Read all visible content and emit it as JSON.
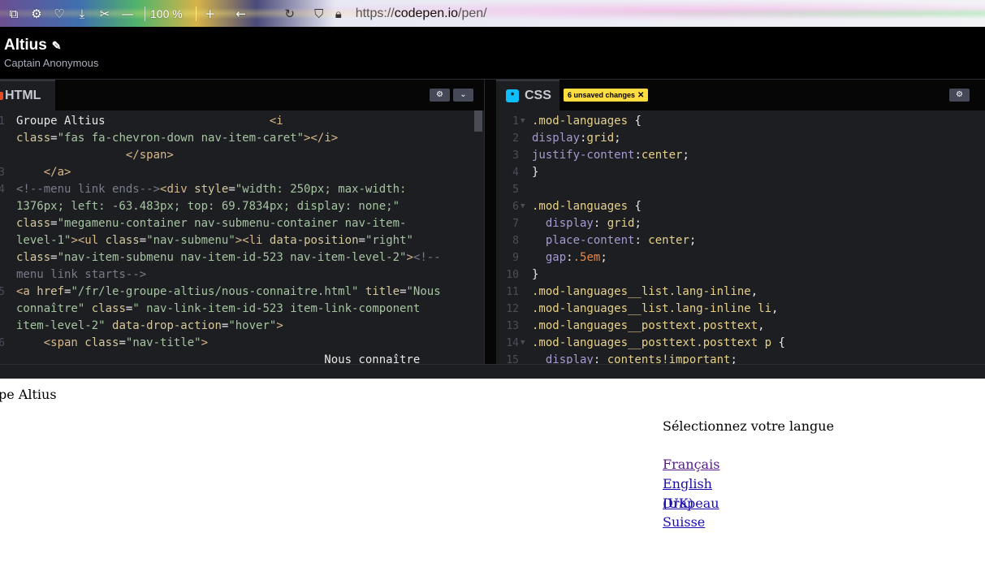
{
  "browser": {
    "zoom": "100 %",
    "url_scheme": "https://",
    "url_host": "codepen.io",
    "url_path": "/pen/",
    "icons": [
      "extensions-icon",
      "settings-icon",
      "pocket-icon",
      "download-icon",
      "screenshot-icon",
      "zoom-out-icon",
      "zoom-in-icon",
      "back-icon",
      "reload-icon",
      "shield-icon",
      "lock-icon"
    ]
  },
  "pen": {
    "title": "Altius",
    "author": "Captain Anonymous"
  },
  "html_pane": {
    "tab_label": "HTML",
    "lines": [
      {
        "n": "1",
        "parts": [
          {
            "c": "c-plain",
            "t": "Groupe Altius"
          },
          {
            "c": "c-tag",
            "t": "                        <i",
            "x": 0
          }
        ]
      },
      {
        "n": "",
        "parts": [
          {
            "c": "c-attr",
            "t": "class"
          },
          {
            "c": "c-plain",
            "t": "="
          },
          {
            "c": "c-str",
            "t": "\"fas fa-chevron-down nav-item-caret\""
          },
          {
            "c": "c-tag",
            "t": "></i>"
          }
        ]
      },
      {
        "n": "",
        "parts": [
          {
            "c": "c-tag",
            "t": "                </span>"
          }
        ]
      },
      {
        "n": "3",
        "parts": [
          {
            "c": "c-tag",
            "t": "    </a>"
          }
        ]
      },
      {
        "n": "4",
        "parts": [
          {
            "c": "c-comment",
            "t": "<!--menu link ends-->"
          },
          {
            "c": "c-tag",
            "t": "<div "
          },
          {
            "c": "c-attr",
            "t": "style"
          },
          {
            "c": "c-plain",
            "t": "="
          },
          {
            "c": "c-str",
            "t": "\"width: 250px; max-width:"
          }
        ]
      },
      {
        "n": "",
        "parts": [
          {
            "c": "c-str",
            "t": "1376px; left: -63.483px; top: 69.7834px; display: none;\""
          }
        ]
      },
      {
        "n": "",
        "parts": [
          {
            "c": "c-attr",
            "t": "class"
          },
          {
            "c": "c-plain",
            "t": "="
          },
          {
            "c": "c-str",
            "t": "\"megamenu-container nav-submenu-container nav-item-"
          }
        ]
      },
      {
        "n": "",
        "parts": [
          {
            "c": "c-str",
            "t": "level-1\""
          },
          {
            "c": "c-tag",
            "t": "><ul "
          },
          {
            "c": "c-attr",
            "t": "class"
          },
          {
            "c": "c-plain",
            "t": "="
          },
          {
            "c": "c-str",
            "t": "\"nav-submenu\""
          },
          {
            "c": "c-tag",
            "t": "><li "
          },
          {
            "c": "c-attr",
            "t": "data-position"
          },
          {
            "c": "c-plain",
            "t": "="
          },
          {
            "c": "c-str",
            "t": "\"right\""
          }
        ]
      },
      {
        "n": "",
        "parts": [
          {
            "c": "c-attr",
            "t": "class"
          },
          {
            "c": "c-plain",
            "t": "="
          },
          {
            "c": "c-str",
            "t": "\"nav-item-submenu nav-item-id-523 nav-item-level-2\""
          },
          {
            "c": "c-tag",
            "t": ">"
          },
          {
            "c": "c-comment",
            "t": "<!--"
          }
        ]
      },
      {
        "n": "",
        "parts": [
          {
            "c": "c-comment",
            "t": "menu link starts-->"
          }
        ]
      },
      {
        "n": "5",
        "parts": [
          {
            "c": "c-tag",
            "t": "<a "
          },
          {
            "c": "c-attr",
            "t": "href"
          },
          {
            "c": "c-plain",
            "t": "="
          },
          {
            "c": "c-str",
            "t": "\"/fr/le-groupe-altius/nous-connaitre.html\""
          },
          {
            "c": "c-plain",
            "t": " "
          },
          {
            "c": "c-attr",
            "t": "title"
          },
          {
            "c": "c-plain",
            "t": "="
          },
          {
            "c": "c-str",
            "t": "\"Nous"
          }
        ]
      },
      {
        "n": "",
        "parts": [
          {
            "c": "c-str",
            "t": "connaître\""
          },
          {
            "c": "c-plain",
            "t": " "
          },
          {
            "c": "c-attr",
            "t": "class"
          },
          {
            "c": "c-plain",
            "t": "="
          },
          {
            "c": "c-str",
            "t": "\" nav-link-item-id-523 item-link-component"
          }
        ]
      },
      {
        "n": "",
        "parts": [
          {
            "c": "c-str",
            "t": "item-level-2\""
          },
          {
            "c": "c-plain",
            "t": " "
          },
          {
            "c": "c-attr",
            "t": "data-drop-action"
          },
          {
            "c": "c-plain",
            "t": "="
          },
          {
            "c": "c-str",
            "t": "\"hover\""
          },
          {
            "c": "c-tag",
            "t": ">"
          }
        ]
      },
      {
        "n": "6",
        "parts": [
          {
            "c": "c-tag",
            "t": "    <span "
          },
          {
            "c": "c-attr",
            "t": "class"
          },
          {
            "c": "c-plain",
            "t": "="
          },
          {
            "c": "c-str",
            "t": "\"nav-title\""
          },
          {
            "c": "c-tag",
            "t": ">"
          }
        ]
      },
      {
        "n": "",
        "parts": [
          {
            "c": "c-plain",
            "t": "                                             Nous connaître"
          }
        ]
      }
    ]
  },
  "css_pane": {
    "tab_label": "CSS",
    "badge": "6 unsaved changes",
    "lines": [
      {
        "n": "1",
        "fold": true,
        "parts": [
          {
            "c": "c-sel",
            "t": ".mod-languages "
          },
          {
            "c": "c-plain",
            "t": "{"
          }
        ]
      },
      {
        "n": "2",
        "parts": [
          {
            "c": "c-prop",
            "t": "display"
          },
          {
            "c": "c-plain",
            "t": ":"
          },
          {
            "c": "c-val",
            "t": "grid"
          },
          {
            "c": "c-plain",
            "t": ";"
          }
        ]
      },
      {
        "n": "3",
        "parts": [
          {
            "c": "c-prop",
            "t": "justify-content"
          },
          {
            "c": "c-plain",
            "t": ":"
          },
          {
            "c": "c-val",
            "t": "center"
          },
          {
            "c": "c-plain",
            "t": ";"
          }
        ]
      },
      {
        "n": "4",
        "parts": [
          {
            "c": "c-plain",
            "t": "}"
          }
        ]
      },
      {
        "n": "5",
        "parts": []
      },
      {
        "n": "6",
        "fold": true,
        "parts": [
          {
            "c": "c-sel",
            "t": ".mod-languages "
          },
          {
            "c": "c-plain",
            "t": "{"
          }
        ]
      },
      {
        "n": "7",
        "parts": [
          {
            "c": "c-prop",
            "t": "  display"
          },
          {
            "c": "c-plain",
            "t": ": "
          },
          {
            "c": "c-val",
            "t": "grid"
          },
          {
            "c": "c-plain",
            "t": ";"
          }
        ]
      },
      {
        "n": "8",
        "parts": [
          {
            "c": "c-prop",
            "t": "  place-content"
          },
          {
            "c": "c-plain",
            "t": ": "
          },
          {
            "c": "c-val",
            "t": "center"
          },
          {
            "c": "c-plain",
            "t": ";"
          }
        ]
      },
      {
        "n": "9",
        "parts": [
          {
            "c": "c-prop",
            "t": "  gap"
          },
          {
            "c": "c-plain",
            "t": ":"
          },
          {
            "c": "c-num",
            "t": ".5em"
          },
          {
            "c": "c-plain",
            "t": ";"
          }
        ]
      },
      {
        "n": "10",
        "parts": [
          {
            "c": "c-plain",
            "t": "}"
          }
        ]
      },
      {
        "n": "11",
        "parts": [
          {
            "c": "c-sel",
            "t": ".mod-languages__list.lang-inline"
          },
          {
            "c": "c-plain",
            "t": ","
          }
        ]
      },
      {
        "n": "12",
        "parts": [
          {
            "c": "c-sel",
            "t": ".mod-languages__list.lang-inline li"
          },
          {
            "c": "c-plain",
            "t": ","
          }
        ]
      },
      {
        "n": "13",
        "parts": [
          {
            "c": "c-sel",
            "t": ".mod-languages__posttext.posttext"
          },
          {
            "c": "c-plain",
            "t": ","
          }
        ]
      },
      {
        "n": "14",
        "fold": true,
        "parts": [
          {
            "c": "c-sel",
            "t": ".mod-languages__posttext.posttext p "
          },
          {
            "c": "c-plain",
            "t": "{"
          }
        ]
      },
      {
        "n": "15",
        "parts": [
          {
            "c": "c-prop",
            "t": "  display"
          },
          {
            "c": "c-plain",
            "t": ": "
          },
          {
            "c": "c-val",
            "t": "contents!important"
          },
          {
            "c": "c-plain",
            "t": ";"
          }
        ]
      }
    ]
  },
  "preview": {
    "text": "pe Altius",
    "lang_heading": "Sélectionnez votre langue",
    "links": [
      {
        "label": "Français",
        "visited": true
      },
      {
        "label": "English",
        "visited": false
      },
      {
        "label": "(UK)",
        "visited": false
      },
      {
        "label": "Drapeau",
        "visited": false
      },
      {
        "label": "Suisse",
        "visited": false
      }
    ]
  }
}
